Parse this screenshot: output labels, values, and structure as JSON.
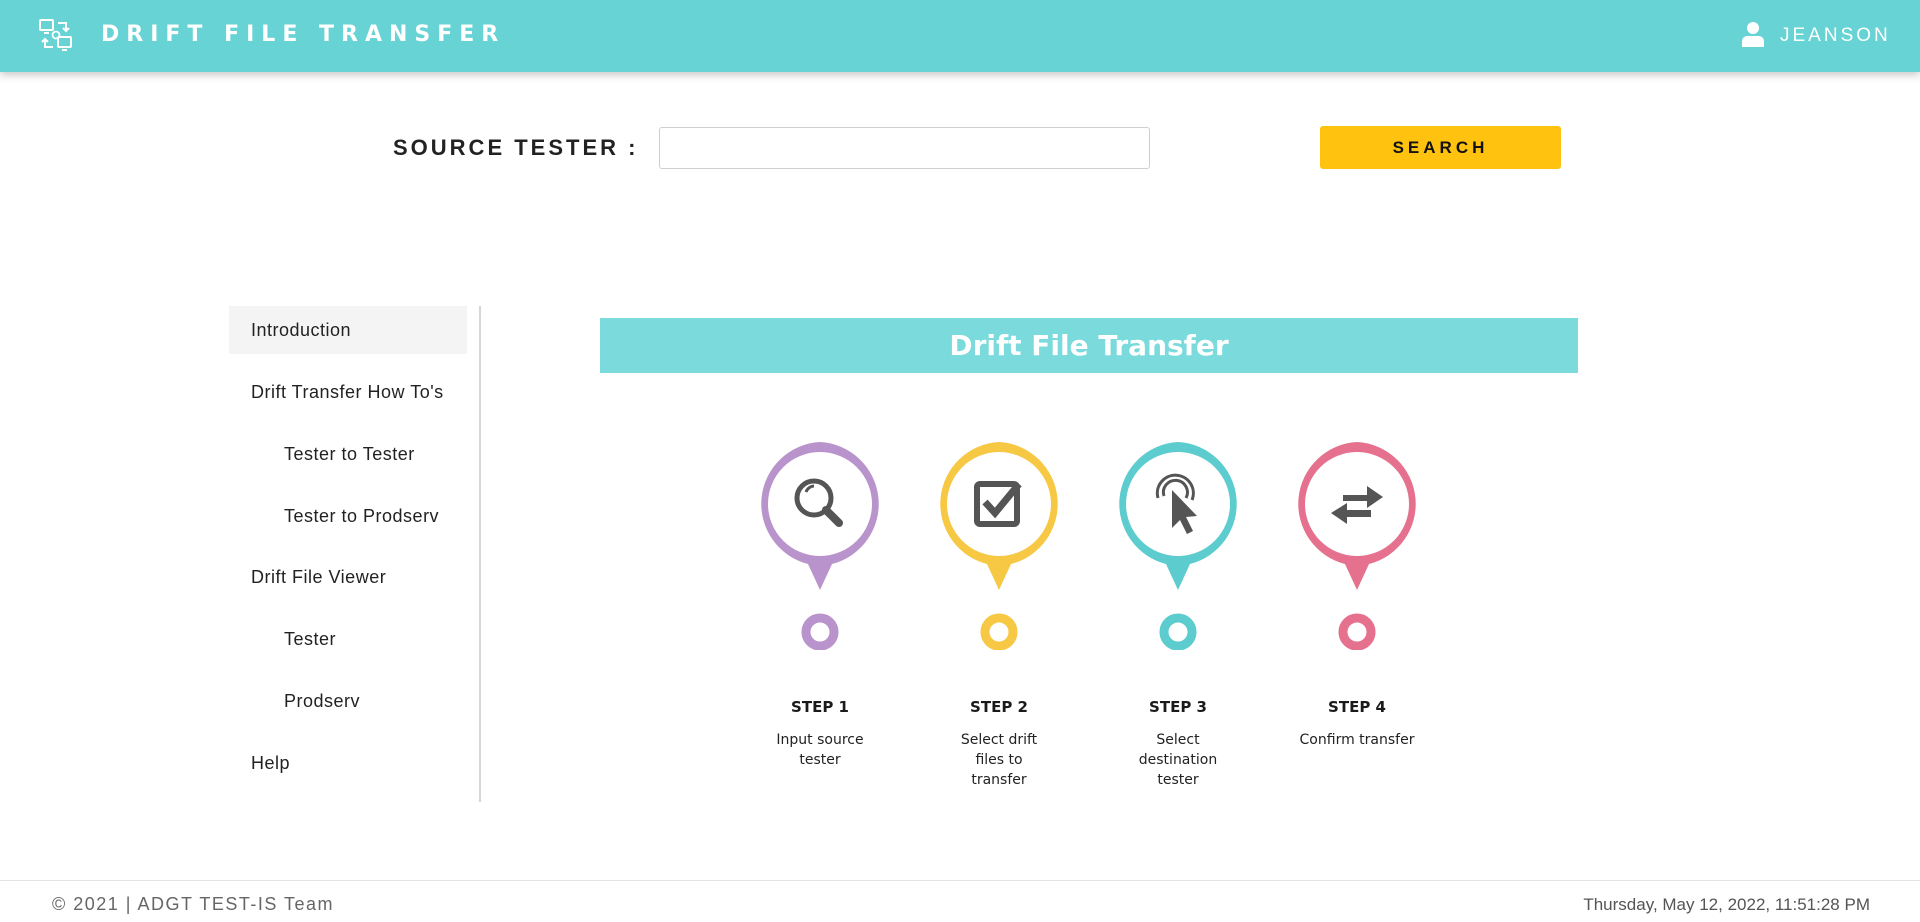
{
  "header": {
    "app_icon": "transfer-devices-icon",
    "title": "DRIFT FILE TRANSFER",
    "user_icon": "user-icon",
    "username": "JEANSON"
  },
  "search": {
    "label": "SOURCE TESTER :",
    "value": "",
    "placeholder": "",
    "button_label": "SEARCH"
  },
  "sidebar": {
    "items": [
      {
        "label": "Introduction",
        "level": 0,
        "active": true
      },
      {
        "label": "Drift Transfer How To's",
        "level": 0
      },
      {
        "label": "Tester to Tester",
        "level": 1
      },
      {
        "label": "Tester to Prodserv",
        "level": 1
      },
      {
        "label": "Drift File Viewer",
        "level": 0
      },
      {
        "label": "Tester",
        "level": 1
      },
      {
        "label": "Prodserv",
        "level": 1
      },
      {
        "label": "Help",
        "level": 0
      }
    ]
  },
  "main": {
    "banner_title": "Drift File Transfer",
    "steps": [
      {
        "title": "STEP 1",
        "description": "Input source tester",
        "icon": "magnifier-icon",
        "color": "#b993cb"
      },
      {
        "title": "STEP 2",
        "description": "Select drift files to transfer",
        "icon": "checkbox-icon",
        "color": "#f7c843"
      },
      {
        "title": "STEP 3",
        "description": "Select destination tester",
        "icon": "pointer-click-icon",
        "color": "#5ccccf"
      },
      {
        "title": "STEP 4",
        "description": "Confirm transfer",
        "icon": "swap-arrows-icon",
        "color": "#e5718f"
      }
    ]
  },
  "footer": {
    "copyright": "© 2021 | ADGT TEST-IS Team",
    "datetime": "Thursday, May 12, 2022, 11:51:28 PM"
  },
  "colors": {
    "header_bg": "#68d3d5",
    "banner_bg": "#7adadc",
    "search_button": "#ffc20e"
  }
}
